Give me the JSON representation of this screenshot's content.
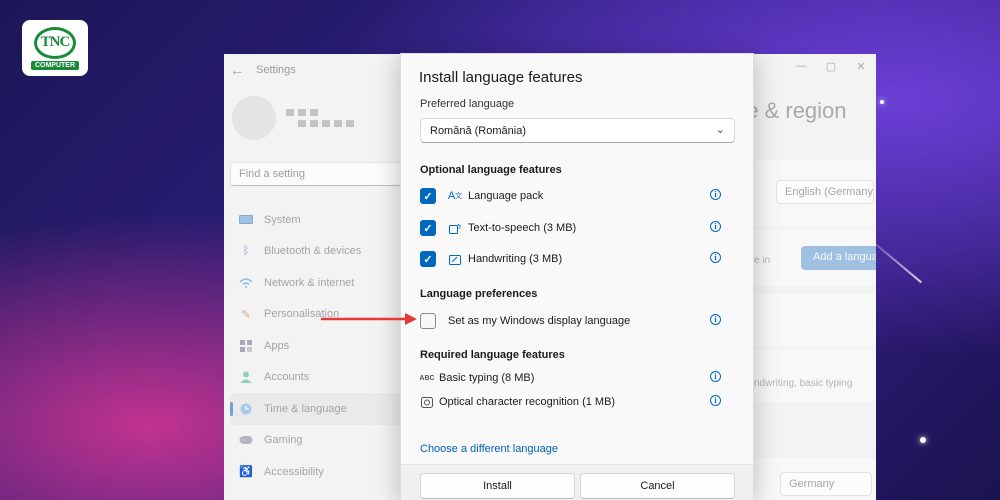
{
  "logo": {
    "main_text": "TNC",
    "sub_text": "COMPUTER"
  },
  "settings": {
    "back_glyph": "←",
    "title": "Settings",
    "window_controls": [
      "—",
      "▢",
      "✕"
    ],
    "search_placeholder": "Find a setting",
    "nav": [
      {
        "label": "System",
        "icon": "monitor-icon"
      },
      {
        "label": "Bluetooth & devices",
        "icon": "bluetooth-icon"
      },
      {
        "label": "Network & internet",
        "icon": "wifi-icon"
      },
      {
        "label": "Personalisation",
        "icon": "brush-icon"
      },
      {
        "label": "Apps",
        "icon": "apps-icon"
      },
      {
        "label": "Accounts",
        "icon": "person-icon"
      },
      {
        "label": "Time & language",
        "icon": "globe-clock-icon",
        "active": true
      },
      {
        "label": "Gaming",
        "icon": "gamepad-icon"
      },
      {
        "label": "Accessibility",
        "icon": "accessibility-icon"
      }
    ],
    "page_title_fragment": "ge & region",
    "display_language_value": "English (Germany)",
    "add_language_label": "Add a langua",
    "fragment_text_1": "e in",
    "fragment_text_2": "ndwriting, basic typing",
    "country_value": "Germany"
  },
  "dialog": {
    "title": "Install language features",
    "preferred_language_label": "Preferred language",
    "preferred_language_value": "Română (România)",
    "optional_heading": "Optional language features",
    "optional_features": [
      {
        "label": "Language pack",
        "checked": true,
        "icon": "language-pack-icon"
      },
      {
        "label": "Text-to-speech (3 MB)",
        "checked": true,
        "icon": "speech-icon"
      },
      {
        "label": "Handwriting (3 MB)",
        "checked": true,
        "icon": "handwriting-icon"
      }
    ],
    "preferences_heading": "Language preferences",
    "display_language_option": {
      "label": "Set as my Windows display language",
      "checked": false
    },
    "required_heading": "Required language features",
    "required_features": [
      {
        "label": "Basic typing (8 MB)",
        "icon": "abc-typing-icon"
      },
      {
        "label": "Optical character recognition (1 MB)",
        "icon": "ocr-icon"
      }
    ],
    "change_language_link": "Choose a different language",
    "install_button": "Install",
    "cancel_button": "Cancel"
  },
  "colors": {
    "accent": "#0067c0",
    "arrow": "#e53935"
  }
}
